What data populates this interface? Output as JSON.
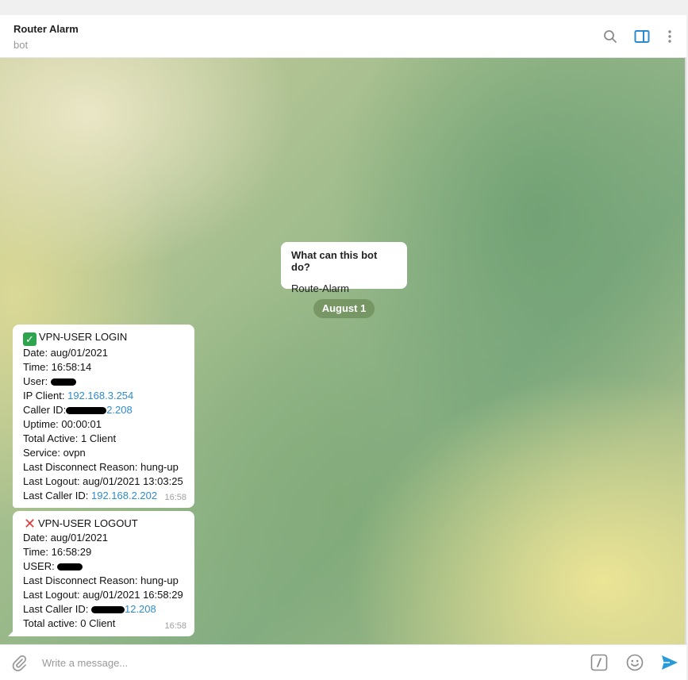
{
  "header": {
    "title": "Router Alarm",
    "subtitle": "bot",
    "icons": [
      "search-icon",
      "side-panel-icon",
      "more-vertical-icon"
    ]
  },
  "bot_card": {
    "question": "What can this bot do?",
    "answer": "Route-Alarm"
  },
  "date_separator": "August 1",
  "messages": [
    {
      "title": "VPN-USER LOGIN",
      "date": "Date: aug/01/2021",
      "time_line": "Time: 16:58:14",
      "user_label": "User: ",
      "ip_label": "IP Client: ",
      "ip_value": "192.168.3.254",
      "caller_label": "Caller ID:",
      "caller_value_tail": "2.208",
      "uptime": "Uptime: 00:00:01",
      "total_active": "Total Active: 1 Client",
      "service": "Service: ovpn",
      "last_disconnect": "Last Disconnect Reason: hung-up",
      "last_logout": "Last Logout: aug/01/2021 13:03:25",
      "last_caller_label": "Last Caller ID: ",
      "last_caller_value": "192.168.2.202",
      "timestamp": "16:58"
    },
    {
      "title": "VPN-USER LOGOUT",
      "date": "Date: aug/01/2021",
      "time_line": "Time: 16:58:29",
      "user_label": "USER: ",
      "last_disconnect": "Last Disconnect Reason: hung-up",
      "last_logout": "Last Logout: aug/01/2021 16:58:29",
      "last_caller_label": "Last Caller ID: ",
      "last_caller_value_tail": "12.208",
      "total_active": "Total active: 0 Client",
      "timestamp": "16:58"
    }
  ],
  "composer": {
    "placeholder": "Write a message..."
  },
  "colors": {
    "link": "#2f8ccd",
    "accent": "#2a8bd0",
    "date_pill": "#6e8c5a"
  }
}
